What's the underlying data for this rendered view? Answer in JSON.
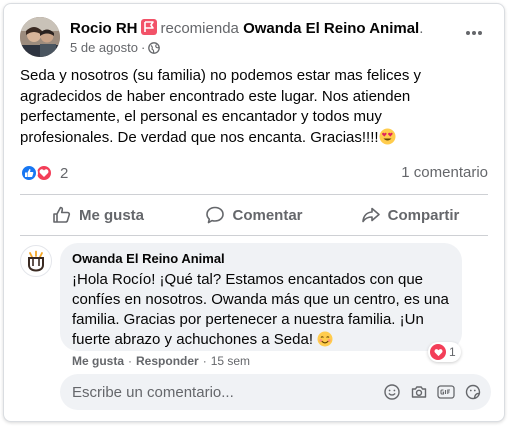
{
  "post": {
    "author": "Rocio RH",
    "recommends_text": "recomienda",
    "page_name": "Owanda El Reino Animal",
    "page_name_suffix": ".",
    "date": "5 de agosto",
    "separator": "·",
    "text": "Seda y nosotros (su familia) no podemos estar mas felices y agradecidos de haber encontrado este lugar. Nos atienden perfectamente, el personal es encantador y todos muy profesionales. De verdad que nos encanta. Gracias!!!!",
    "reaction_count": "2",
    "comments_count": "1 comentario"
  },
  "actions": {
    "like": "Me gusta",
    "comment": "Comentar",
    "share": "Compartir"
  },
  "comment": {
    "author": "Owanda El Reino Animal",
    "text": "¡Hola Rocío! ¡Qué tal? Estamos encantados con que confíes en nosotros. Owanda más que un centro, es una familia. Gracias por pertenecer a nuestra familia. ¡Un fuerte abrazo y achuchones a Seda!",
    "reaction_count": "1",
    "like_label": "Me gusta",
    "reply_label": "Responder",
    "time": "15 sem",
    "dot": "·"
  },
  "composer": {
    "placeholder": "Escribe un comentario..."
  },
  "icons": {
    "more": "more-horizontal-icon",
    "globe": "globe-icon",
    "recommend_badge": "recommend-flag-icon",
    "like_reaction": "like-reaction-icon",
    "love_reaction": "love-reaction-icon",
    "heart_eyes_emoji": "heart-eyes-emoji-icon",
    "blush_emoji": "smiling-emoji-icon"
  },
  "colors": {
    "brand_blue": "#1877f2",
    "love_red": "#f33e58",
    "recommend_pink": "#f25268",
    "secondary_text": "#65676b",
    "bubble_bg": "#f0f2f5"
  }
}
